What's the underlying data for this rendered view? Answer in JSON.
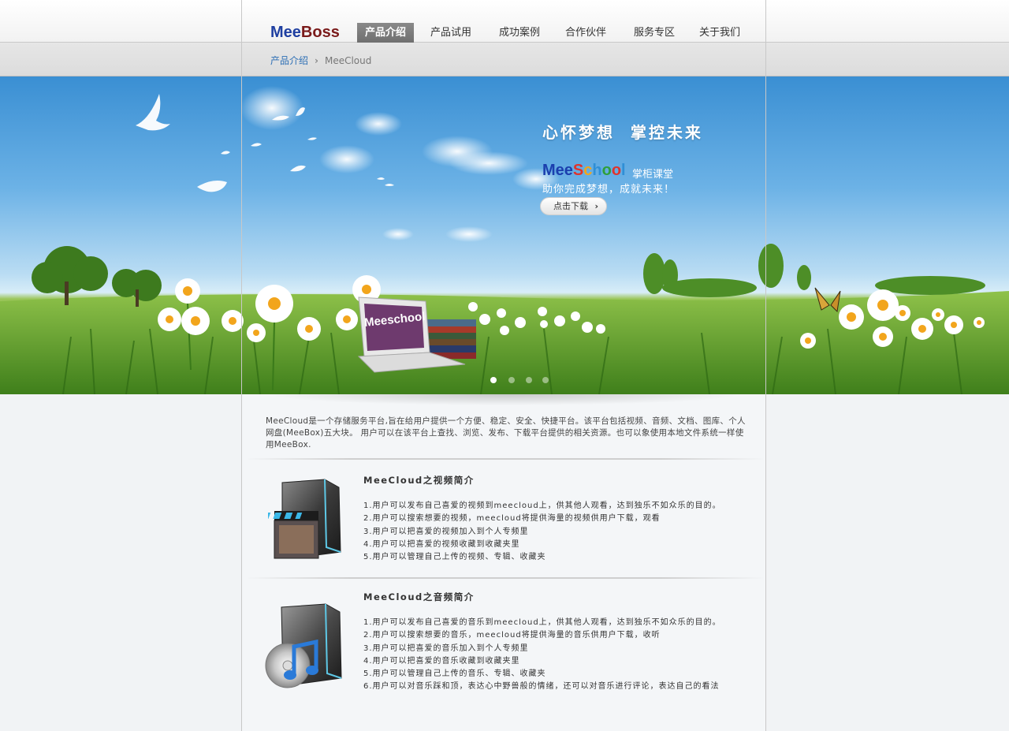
{
  "header": {
    "logo_part1": "Mee",
    "logo_part2": "Boss",
    "nav": [
      {
        "label": "产品介绍",
        "active": true
      },
      {
        "label": "产品试用"
      },
      {
        "label": "成功案例"
      },
      {
        "label": "合作伙伴"
      },
      {
        "label": "服务专区"
      },
      {
        "label": "关于我们"
      }
    ]
  },
  "breadcrumb": {
    "link": "产品介绍",
    "separator": "›",
    "current": "MeeCloud"
  },
  "banner": {
    "slogan": "心怀梦想  掌控未来",
    "brand_parts": [
      {
        "text": "Mee",
        "color": "#1b3fae"
      },
      {
        "text": "S",
        "color": "#e0332c"
      },
      {
        "text": "c",
        "color": "#f2a51c"
      },
      {
        "text": "h",
        "color": "#2f8fd6"
      },
      {
        "text": "o",
        "color": "#2f9f3a"
      },
      {
        "text": "o",
        "color": "#e0332c"
      },
      {
        "text": "l",
        "color": "#2f8fd6"
      }
    ],
    "brand_sub": "掌柜课堂",
    "tagline": "助你完成梦想，成就未来！",
    "button_label": "点击下载",
    "button_arrow": "›",
    "laptop_screen_text": "Meeschool",
    "slides": 4,
    "active_slide": 0
  },
  "intro": "MeeCloud是一个存储服务平台,旨在给用户提供一个方便、稳定、安全、快捷平台。该平台包括视频、音频、文档、图库、个人网盘(MeeBox)五大块。 用户可以在该平台上查找、浏览、发布、下载平台提供的相关资源。也可以象使用本地文件系统一样使用MeeBox.",
  "sections": [
    {
      "title": "MeeCloud之视频简介",
      "icon": "video-folder-icon",
      "items": [
        "1.用户可以发布自己喜爱的视频到meecloud上，供其他人观看，达到独乐不如众乐的目的。",
        "2.用户可以搜索想要的视频，meecloud将提供海量的视频供用户下载，观看",
        "3.用户可以把喜爱的视频加入到个人专频里",
        "4.用户可以把喜爱的视频收藏到收藏夹里",
        "5.用户可以管理自己上传的视频、专辑、收藏夹"
      ]
    },
    {
      "title": "MeeCloud之音频简介",
      "icon": "music-folder-icon",
      "items": [
        "1.用户可以发布自己喜爱的音乐到meecloud上，供其他人观看，达到独乐不如众乐的目的。",
        "2.用户可以搜索想要的音乐，meecloud将提供海量的音乐供用户下载，收听",
        "3.用户可以把喜爱的音乐加入到个人专频里",
        "4.用户可以把喜爱的音乐收藏到收藏夹里",
        "5.用户可以管理自己上传的音乐、专辑、收藏夹",
        "6.用户可以对音乐踩和顶，表达心中野兽般的情绪，还可以对音乐进行评论，表达自己的看法"
      ]
    }
  ]
}
